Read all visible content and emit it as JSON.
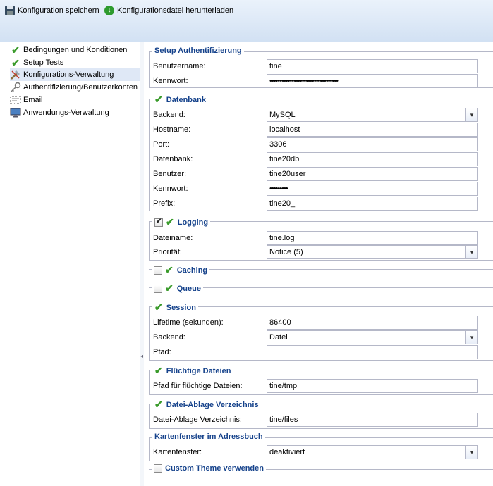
{
  "toolbar": {
    "save_label": "Konfiguration speichern",
    "download_label": "Konfigurationsdatei herunterladen"
  },
  "tree": {
    "items": [
      {
        "label": "Bedingungen und Konditionen",
        "icon": "check-icon"
      },
      {
        "label": "Setup Tests",
        "icon": "check-icon"
      },
      {
        "label": "Konfigurations-Verwaltung",
        "icon": "tools-icon"
      },
      {
        "label": "Authentifizierung/Benutzerkonten",
        "icon": "key-icon"
      },
      {
        "label": "Email",
        "icon": "email-icon"
      },
      {
        "label": "Anwendungs-Verwaltung",
        "icon": "monitor-icon"
      }
    ]
  },
  "auth": {
    "title": "Setup Authentifizierung",
    "username_label": "Benutzername:",
    "username_value": "tine",
    "password_label": "Kennwort:",
    "password_value": "••••••••••••••••••••••••••••••••••"
  },
  "db": {
    "title": "Datenbank",
    "backend_label": "Backend:",
    "backend_value": "MySQL",
    "host_label": "Hostname:",
    "host_value": "localhost",
    "port_label": "Port:",
    "port_value": "3306",
    "dbname_label": "Datenbank:",
    "dbname_value": "tine20db",
    "user_label": "Benutzer:",
    "user_value": "tine20user",
    "pass_label": "Kennwort:",
    "pass_value": "•••••••••",
    "prefix_label": "Prefix:",
    "prefix_value": "tine20_"
  },
  "logging": {
    "title": "Logging",
    "file_label": "Dateiname:",
    "file_value": "tine.log",
    "prio_label": "Priorität:",
    "prio_value": "Notice (5)"
  },
  "caching": {
    "title": "Caching"
  },
  "queue": {
    "title": "Queue"
  },
  "session": {
    "title": "Session",
    "lifetime_label": "Lifetime (sekunden):",
    "lifetime_value": "86400",
    "backend_label": "Backend:",
    "backend_value": "Datei",
    "path_label": "Pfad:",
    "path_value": ""
  },
  "tmp": {
    "title": "Flüchtige Dateien",
    "path_label": "Pfad für flüchtige Dateien:",
    "path_value": "tine/tmp"
  },
  "files": {
    "title": "Datei-Ablage Verzeichnis",
    "path_label": "Datei-Ablage Verzeichnis:",
    "path_value": "tine/files"
  },
  "map": {
    "title": "Kartenfenster im Adressbuch",
    "label": "Kartenfenster:",
    "value": "deaktiviert"
  },
  "theme": {
    "title": "Custom Theme verwenden"
  },
  "colors": {
    "accent": "#15428b",
    "check": "#3a9b2b",
    "selected": "#dfe8f6"
  }
}
